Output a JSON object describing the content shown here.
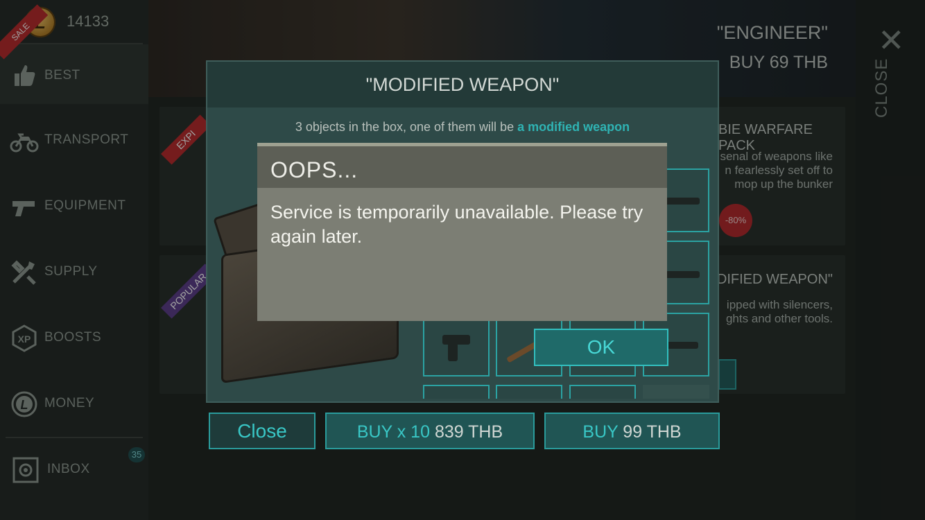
{
  "sidebar": {
    "coin_symbol": "L",
    "currency": "14133",
    "sale_badge": "SALE",
    "items": [
      {
        "label": "BEST",
        "icon": "thumbs-up-icon"
      },
      {
        "label": "TRANSPORT",
        "icon": "motorbike-icon"
      },
      {
        "label": "EQUIPMENT",
        "icon": "pistol-icon"
      },
      {
        "label": "SUPPLY",
        "icon": "tools-icon"
      },
      {
        "label": "BOOSTS",
        "icon": "xp-icon"
      },
      {
        "label": "MONEY",
        "icon": "coin-icon"
      },
      {
        "label": "INBOX",
        "icon": "safe-icon"
      }
    ],
    "xp_icon_text": "XP",
    "money_icon_text": "L",
    "inbox_count": "35"
  },
  "banner": {
    "title": "\"ENGINEER\"",
    "price": "BUY 69 THB"
  },
  "close_panel": {
    "label": "CLOSE"
  },
  "bg_cards": {
    "expired_badge": "EXPI",
    "popular_badge": "POPULAR",
    "card1_title": "BIE WARFARE PACK",
    "card1_desc_1": "senal of weapons like",
    "card1_desc_2": "n fearlessly set off to",
    "card1_desc_3": "mop up the bunker",
    "card1_discount": "-80%",
    "card2_title": "ODIFIED WEAPON\"",
    "card2_desc_1": "ipped with silencers,",
    "card2_desc_2": "ghts and other tools."
  },
  "weapon_dialog": {
    "title": "\"MODIFIED WEAPON\"",
    "subtitle_prefix": "3 objects in the box, one of them will be ",
    "subtitle_highlight": "a modified weapon",
    "close_label": "Close",
    "buy10_label": "BUY x 10",
    "buy10_price": "839 THB",
    "buy_label": "BUY",
    "buy_price": "99 THB"
  },
  "oops_dialog": {
    "title": "OOPS...",
    "message": "Service is temporarily unavailable. Please try again later.",
    "ok_label": "OK"
  },
  "colors": {
    "accent": "#2fb3b3",
    "modal_bg": "#7c7e74",
    "modal_header": "#5d5f56",
    "sale_red": "#b8272a"
  }
}
